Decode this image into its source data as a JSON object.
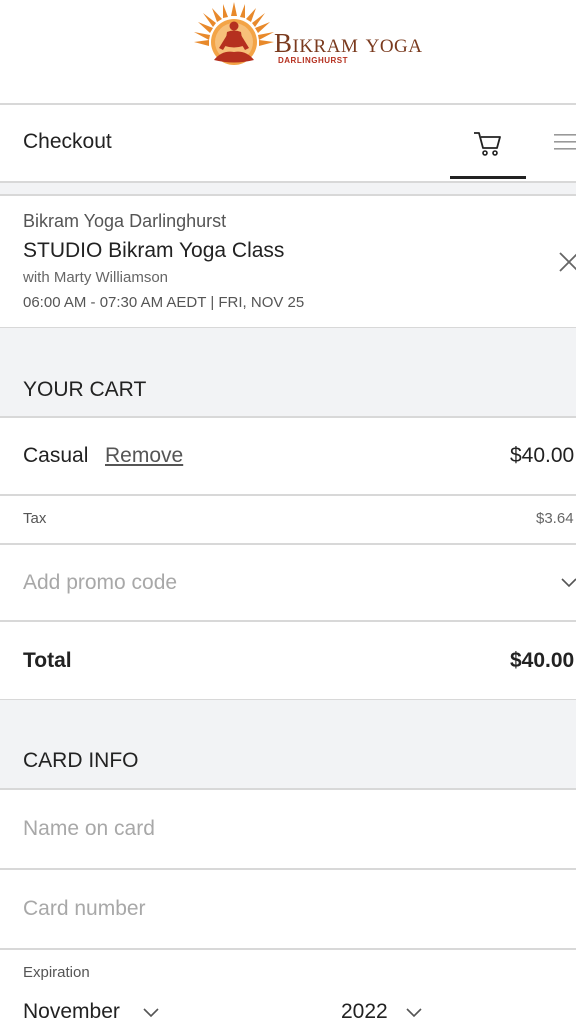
{
  "logo": {
    "name": "Bikram yoga",
    "location": "DARLINGHURST"
  },
  "header": {
    "title": "Checkout",
    "cart_icon": "cart-icon",
    "menu_icon": "hamburger-menu-icon"
  },
  "booking": {
    "studio": "Bikram Yoga Darlinghurst",
    "class_name": "STUDIO Bikram Yoga Class",
    "instructor": "with Marty Williamson",
    "time": "06:00 AM - 07:30 AM AEDT | FRI, NOV 25",
    "close_icon": "close-icon"
  },
  "cart": {
    "heading": "YOUR CART",
    "item_name": "Casual",
    "remove_label": "Remove",
    "item_price": "$40.00",
    "tax_label": "Tax",
    "tax_value": "$3.64",
    "promo_placeholder": "Add promo code",
    "total_label": "Total",
    "total_value": "$40.00"
  },
  "card": {
    "heading": "CARD INFO",
    "name_placeholder": "Name on card",
    "number_placeholder": "Card number",
    "expiration_label": "Expiration",
    "month_value": "November",
    "year_value": "2022"
  },
  "colors": {
    "logo_orange": "#e8892b",
    "logo_red": "#b5301f",
    "logo_brown": "#7a3a1e"
  }
}
